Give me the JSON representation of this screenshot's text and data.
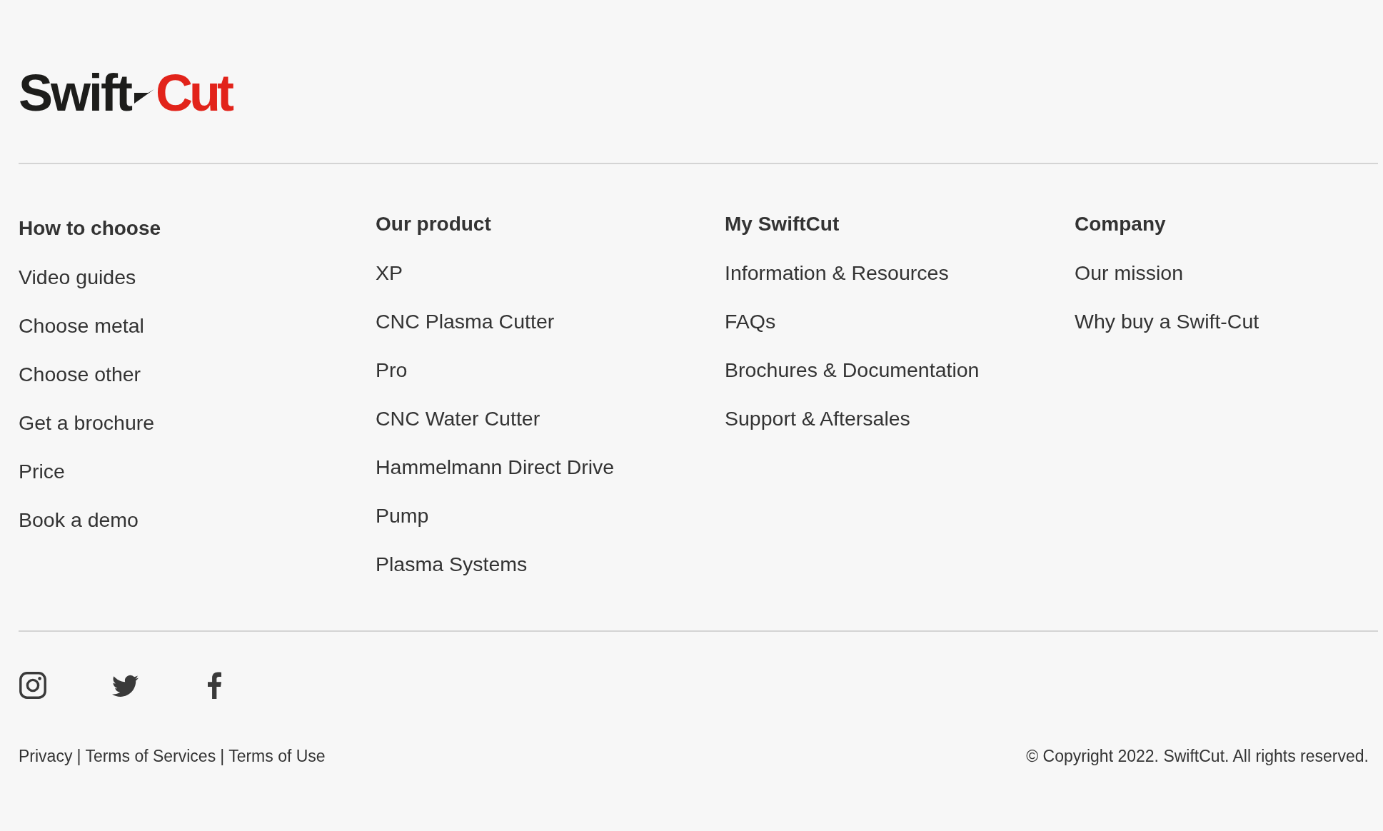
{
  "logo": {
    "first_word": "Swift",
    "second_word": "Cut"
  },
  "columns": [
    {
      "heading": "How to choose",
      "links": [
        "Video guides",
        "Choose metal",
        "Choose other",
        "Get a brochure",
        "Price",
        "Book a demo"
      ]
    },
    {
      "heading": "Our product",
      "links": [
        "XP",
        "CNC Plasma Cutter",
        "Pro",
        "CNC Water Cutter",
        "Hammelmann Direct Drive",
        "Pump",
        "Plasma Systems"
      ]
    },
    {
      "heading": "My SwiftCut",
      "links": [
        "Information & Resources",
        "FAQs",
        "Brochures & Documentation",
        "Support & Aftersales"
      ]
    },
    {
      "heading": "Company",
      "links": [
        "Our mission",
        "Why buy a Swift-Cut"
      ]
    }
  ],
  "legal_links": [
    {
      "kind": "link",
      "text": "Privacy"
    },
    {
      "kind": "separator",
      "text": "|"
    },
    {
      "kind": "link",
      "text": "Terms of Services"
    },
    {
      "kind": "separator",
      "text": "|"
    },
    {
      "kind": "link",
      "text": "Terms of Use"
    }
  ],
  "copyright": "© Copyright 2022. SwiftCut. All rights reserved."
}
